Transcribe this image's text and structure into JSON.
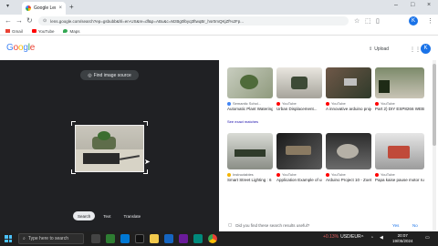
{
  "browser": {
    "tab_title": "Google Lens",
    "url": "lens.google.com/search?ep=gsbubb&hl=en-US&re=df&p=ABu&c=MzBg0lbyq3ftwqBr_hsr0mQKjZf%2Fp..."
  },
  "bookmarks": [
    {
      "label": "Gmail",
      "color": "#ea4335"
    },
    {
      "label": "YouTube",
      "color": "#ff0000"
    },
    {
      "label": "Maps",
      "color": "#34a853"
    }
  ],
  "header": {
    "logo_letters": [
      "G",
      "o",
      "o",
      "g",
      "l",
      "e"
    ],
    "upload_label": "Upload",
    "avatar_letter": "K"
  },
  "lens": {
    "find_source_label": "Find image source",
    "modes": [
      {
        "label": "Search",
        "active": true
      },
      {
        "label": "Text",
        "active": false
      },
      {
        "label": "Translate",
        "active": false
      }
    ]
  },
  "results": {
    "row1": [
      {
        "source": "Semantic Schol...",
        "title": "Automatic Plant Watering System v...",
        "exact": "See exact matches",
        "color": "#4285f4"
      },
      {
        "source": "YouTube",
        "title": "Urban Displacement...",
        "exact": "",
        "color": "#ff0000"
      },
      {
        "source": "YouTube",
        "title": "A innovative arduino project / ...",
        "exact": "",
        "color": "#ff0000"
      },
      {
        "source": "YouTube",
        "title": "Part 2) DIY ESP8266 WEB SERVER...",
        "exact": "",
        "color": "#ff0000"
      }
    ],
    "row2": [
      {
        "source": "Instructables",
        "title": "Smart Street Lighting : 6 Steps - ...",
        "color": "#f4b400"
      },
      {
        "source": "YouTube",
        "title": "Application Example of using the 5Vp...",
        "color": "#ff0000"
      },
      {
        "source": "YouTube",
        "title": "Arduino Project 10 - Zoetrope - YouTube",
        "color": "#ff0000"
      },
      {
        "source": "YouTube",
        "title": "Papa kaise pause motor runs...",
        "color": "#ff0000"
      }
    ],
    "feedback_question": "Did you find these search results useful?",
    "yes_label": "Yes",
    "no_label": "No"
  },
  "taskbar": {
    "search_placeholder": "Type here to search",
    "weather_value": "+0.13%",
    "weather_label": "USD/EUR",
    "time": "20:07",
    "date": "19/05/2024"
  }
}
